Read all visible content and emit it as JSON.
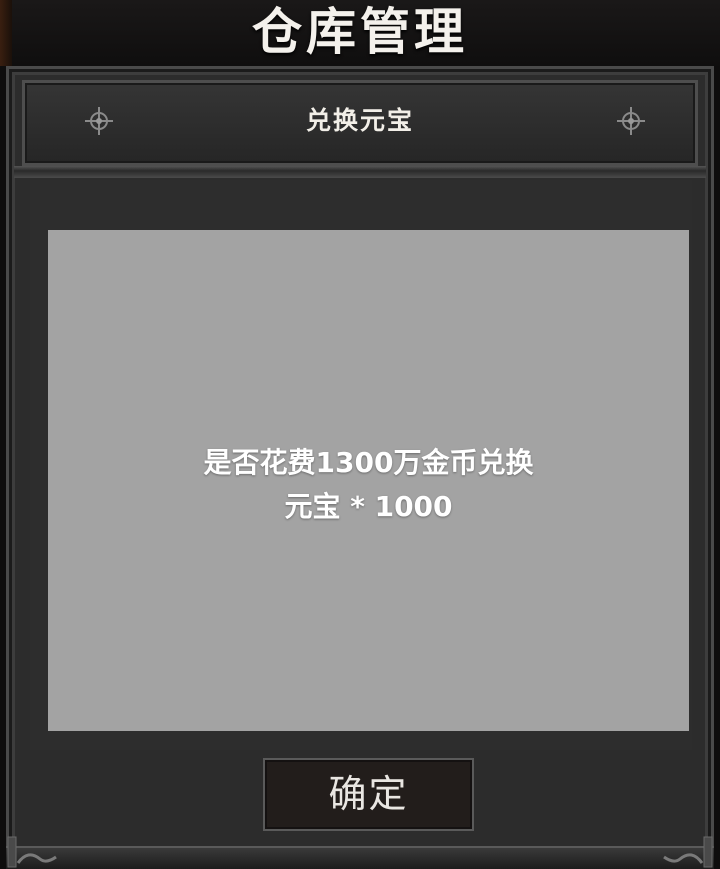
{
  "page": {
    "title": "仓库管理"
  },
  "dialog": {
    "header_title": "兑换元宝",
    "message_line1": "是否花费1300万金币兑换",
    "message_line2": "元宝 * 1000",
    "confirm_label": "确定"
  },
  "icons": {
    "header_left": "ornament-icon",
    "header_right": "ornament-icon",
    "footer_left": "scroll-ornament-icon",
    "footer_right": "scroll-ornament-icon"
  },
  "colors": {
    "panel_background": "#2c2c2c",
    "message_box": "#a3a3a3",
    "text": "#ffffff"
  }
}
